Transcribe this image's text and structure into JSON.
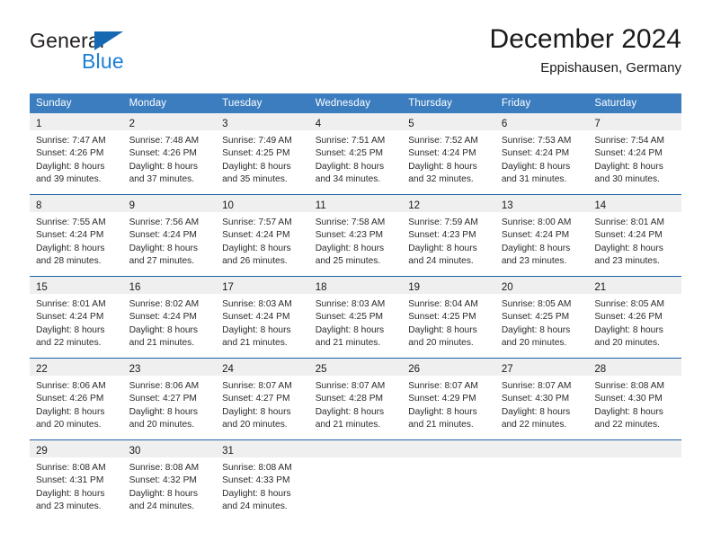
{
  "brand": {
    "name_part1": "General",
    "name_part2": "Blue",
    "triangle_color": "#1668b3",
    "blue_color": "#1c7fd4"
  },
  "header": {
    "title": "December 2024",
    "location": "Eppishausen, Germany"
  },
  "theme": {
    "header_row_bg": "#3b7dbf",
    "row_divider": "#1e63a8",
    "daynum_band_bg": "#efefef",
    "text_color": "#2a2a2a"
  },
  "weekday_headers": [
    "Sunday",
    "Monday",
    "Tuesday",
    "Wednesday",
    "Thursday",
    "Friday",
    "Saturday"
  ],
  "weeks": [
    [
      {
        "day": "1",
        "sunrise": "Sunrise: 7:47 AM",
        "sunset": "Sunset: 4:26 PM",
        "daylight_1": "Daylight: 8 hours",
        "daylight_2": "and 39 minutes."
      },
      {
        "day": "2",
        "sunrise": "Sunrise: 7:48 AM",
        "sunset": "Sunset: 4:26 PM",
        "daylight_1": "Daylight: 8 hours",
        "daylight_2": "and 37 minutes."
      },
      {
        "day": "3",
        "sunrise": "Sunrise: 7:49 AM",
        "sunset": "Sunset: 4:25 PM",
        "daylight_1": "Daylight: 8 hours",
        "daylight_2": "and 35 minutes."
      },
      {
        "day": "4",
        "sunrise": "Sunrise: 7:51 AM",
        "sunset": "Sunset: 4:25 PM",
        "daylight_1": "Daylight: 8 hours",
        "daylight_2": "and 34 minutes."
      },
      {
        "day": "5",
        "sunrise": "Sunrise: 7:52 AM",
        "sunset": "Sunset: 4:24 PM",
        "daylight_1": "Daylight: 8 hours",
        "daylight_2": "and 32 minutes."
      },
      {
        "day": "6",
        "sunrise": "Sunrise: 7:53 AM",
        "sunset": "Sunset: 4:24 PM",
        "daylight_1": "Daylight: 8 hours",
        "daylight_2": "and 31 minutes."
      },
      {
        "day": "7",
        "sunrise": "Sunrise: 7:54 AM",
        "sunset": "Sunset: 4:24 PM",
        "daylight_1": "Daylight: 8 hours",
        "daylight_2": "and 30 minutes."
      }
    ],
    [
      {
        "day": "8",
        "sunrise": "Sunrise: 7:55 AM",
        "sunset": "Sunset: 4:24 PM",
        "daylight_1": "Daylight: 8 hours",
        "daylight_2": "and 28 minutes."
      },
      {
        "day": "9",
        "sunrise": "Sunrise: 7:56 AM",
        "sunset": "Sunset: 4:24 PM",
        "daylight_1": "Daylight: 8 hours",
        "daylight_2": "and 27 minutes."
      },
      {
        "day": "10",
        "sunrise": "Sunrise: 7:57 AM",
        "sunset": "Sunset: 4:24 PM",
        "daylight_1": "Daylight: 8 hours",
        "daylight_2": "and 26 minutes."
      },
      {
        "day": "11",
        "sunrise": "Sunrise: 7:58 AM",
        "sunset": "Sunset: 4:23 PM",
        "daylight_1": "Daylight: 8 hours",
        "daylight_2": "and 25 minutes."
      },
      {
        "day": "12",
        "sunrise": "Sunrise: 7:59 AM",
        "sunset": "Sunset: 4:23 PM",
        "daylight_1": "Daylight: 8 hours",
        "daylight_2": "and 24 minutes."
      },
      {
        "day": "13",
        "sunrise": "Sunrise: 8:00 AM",
        "sunset": "Sunset: 4:24 PM",
        "daylight_1": "Daylight: 8 hours",
        "daylight_2": "and 23 minutes."
      },
      {
        "day": "14",
        "sunrise": "Sunrise: 8:01 AM",
        "sunset": "Sunset: 4:24 PM",
        "daylight_1": "Daylight: 8 hours",
        "daylight_2": "and 23 minutes."
      }
    ],
    [
      {
        "day": "15",
        "sunrise": "Sunrise: 8:01 AM",
        "sunset": "Sunset: 4:24 PM",
        "daylight_1": "Daylight: 8 hours",
        "daylight_2": "and 22 minutes."
      },
      {
        "day": "16",
        "sunrise": "Sunrise: 8:02 AM",
        "sunset": "Sunset: 4:24 PM",
        "daylight_1": "Daylight: 8 hours",
        "daylight_2": "and 21 minutes."
      },
      {
        "day": "17",
        "sunrise": "Sunrise: 8:03 AM",
        "sunset": "Sunset: 4:24 PM",
        "daylight_1": "Daylight: 8 hours",
        "daylight_2": "and 21 minutes."
      },
      {
        "day": "18",
        "sunrise": "Sunrise: 8:03 AM",
        "sunset": "Sunset: 4:25 PM",
        "daylight_1": "Daylight: 8 hours",
        "daylight_2": "and 21 minutes."
      },
      {
        "day": "19",
        "sunrise": "Sunrise: 8:04 AM",
        "sunset": "Sunset: 4:25 PM",
        "daylight_1": "Daylight: 8 hours",
        "daylight_2": "and 20 minutes."
      },
      {
        "day": "20",
        "sunrise": "Sunrise: 8:05 AM",
        "sunset": "Sunset: 4:25 PM",
        "daylight_1": "Daylight: 8 hours",
        "daylight_2": "and 20 minutes."
      },
      {
        "day": "21",
        "sunrise": "Sunrise: 8:05 AM",
        "sunset": "Sunset: 4:26 PM",
        "daylight_1": "Daylight: 8 hours",
        "daylight_2": "and 20 minutes."
      }
    ],
    [
      {
        "day": "22",
        "sunrise": "Sunrise: 8:06 AM",
        "sunset": "Sunset: 4:26 PM",
        "daylight_1": "Daylight: 8 hours",
        "daylight_2": "and 20 minutes."
      },
      {
        "day": "23",
        "sunrise": "Sunrise: 8:06 AM",
        "sunset": "Sunset: 4:27 PM",
        "daylight_1": "Daylight: 8 hours",
        "daylight_2": "and 20 minutes."
      },
      {
        "day": "24",
        "sunrise": "Sunrise: 8:07 AM",
        "sunset": "Sunset: 4:27 PM",
        "daylight_1": "Daylight: 8 hours",
        "daylight_2": "and 20 minutes."
      },
      {
        "day": "25",
        "sunrise": "Sunrise: 8:07 AM",
        "sunset": "Sunset: 4:28 PM",
        "daylight_1": "Daylight: 8 hours",
        "daylight_2": "and 21 minutes."
      },
      {
        "day": "26",
        "sunrise": "Sunrise: 8:07 AM",
        "sunset": "Sunset: 4:29 PM",
        "daylight_1": "Daylight: 8 hours",
        "daylight_2": "and 21 minutes."
      },
      {
        "day": "27",
        "sunrise": "Sunrise: 8:07 AM",
        "sunset": "Sunset: 4:30 PM",
        "daylight_1": "Daylight: 8 hours",
        "daylight_2": "and 22 minutes."
      },
      {
        "day": "28",
        "sunrise": "Sunrise: 8:08 AM",
        "sunset": "Sunset: 4:30 PM",
        "daylight_1": "Daylight: 8 hours",
        "daylight_2": "and 22 minutes."
      }
    ],
    [
      {
        "day": "29",
        "sunrise": "Sunrise: 8:08 AM",
        "sunset": "Sunset: 4:31 PM",
        "daylight_1": "Daylight: 8 hours",
        "daylight_2": "and 23 minutes."
      },
      {
        "day": "30",
        "sunrise": "Sunrise: 8:08 AM",
        "sunset": "Sunset: 4:32 PM",
        "daylight_1": "Daylight: 8 hours",
        "daylight_2": "and 24 minutes."
      },
      {
        "day": "31",
        "sunrise": "Sunrise: 8:08 AM",
        "sunset": "Sunset: 4:33 PM",
        "daylight_1": "Daylight: 8 hours",
        "daylight_2": "and 24 minutes."
      },
      {
        "day": "",
        "sunrise": "",
        "sunset": "",
        "daylight_1": "",
        "daylight_2": ""
      },
      {
        "day": "",
        "sunrise": "",
        "sunset": "",
        "daylight_1": "",
        "daylight_2": ""
      },
      {
        "day": "",
        "sunrise": "",
        "sunset": "",
        "daylight_1": "",
        "daylight_2": ""
      },
      {
        "day": "",
        "sunrise": "",
        "sunset": "",
        "daylight_1": "",
        "daylight_2": ""
      }
    ]
  ]
}
